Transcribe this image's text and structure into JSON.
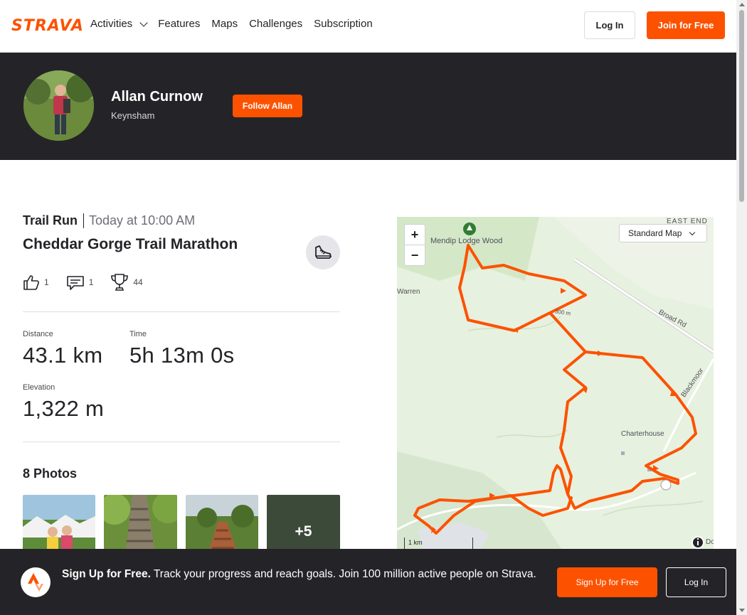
{
  "nav": {
    "logo": "STRAVA",
    "links": [
      "Activities",
      "Features",
      "Maps",
      "Challenges",
      "Subscription"
    ],
    "login": "Log In",
    "join": "Join for Free"
  },
  "athlete": {
    "name": "Allan Curnow",
    "location": "Keynsham",
    "follow": "Follow Allan"
  },
  "activity": {
    "type": "Trail Run",
    "date": "Today at 10:00 AM",
    "title": "Cheddar Gorge Trail Marathon",
    "kudos": "1",
    "comments": "1",
    "achievements": "44",
    "stats": [
      {
        "label": "Distance",
        "value": "43.1 km"
      },
      {
        "label": "Time",
        "value": "5h 13m 0s"
      },
      {
        "label": "Elevation",
        "value": "1,322 m"
      }
    ],
    "photos_title": "8 Photos",
    "photos_more": "+5"
  },
  "map": {
    "zoom_in": "+",
    "zoom_out": "−",
    "style_select": "Standard Map",
    "labels": {
      "east_end": "EAST END",
      "lodge_wood": "Mendip Lodge Wood",
      "warren": "Warren",
      "broad_rd": "Broad Rd",
      "blackmoor": "Blackmoor",
      "charterhouse": "Charterhouse",
      "contour": "300 m",
      "corner": "Do"
    },
    "scale": "1 km",
    "colors": {
      "route": "#fc5200",
      "land": "#e7f1df"
    }
  },
  "signup": {
    "bold": "Sign Up for Free.",
    "text": " Track your progress and reach goals. Join 100 million active people on Strava.",
    "button": "Sign Up for Free",
    "login": "Log In"
  },
  "colors": {
    "brand": "#fc5200",
    "dark": "#242428"
  }
}
